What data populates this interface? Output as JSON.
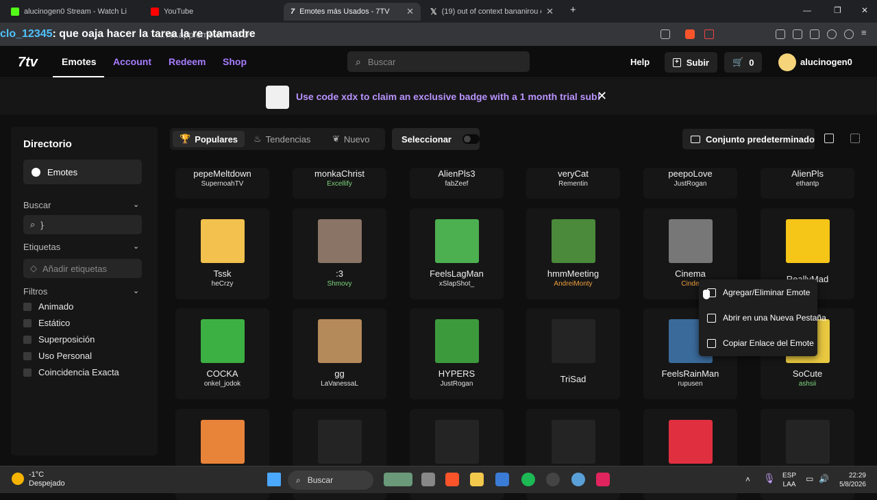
{
  "browser": {
    "tabs": [
      {
        "title": "alucinogen0 Stream - Watch Live"
      },
      {
        "title": "YouTube"
      },
      {
        "title": "Emotes más Usados - 7TV"
      },
      {
        "title": "(19) out of context bananirou en X:"
      }
    ],
    "new_tab": "+",
    "url_fragment": "...7tv.app/emotes?...7D"
  },
  "chat_overlay": {
    "user": "clo_12345",
    "message": ": que oaja hacer la tarea la re ptamadre"
  },
  "nav": {
    "logo": "7tv",
    "links": [
      "Emotes",
      "Account",
      "Redeem",
      "Shop"
    ],
    "search_placeholder": "Buscar",
    "help": "Help",
    "upload": "Subir",
    "cart_count": "0",
    "username": "alucinogen0"
  },
  "banner": {
    "text": "Use code xdx to claim an exclusive badge with a 1 month trial sub!",
    "close": "✕"
  },
  "sidebar": {
    "title": "Directorio",
    "emotes_button": "Emotes",
    "search_header": "Buscar",
    "search_value": "}",
    "tags_header": "Etiquetas",
    "tags_placeholder": "Añadir etiquetas",
    "filters_header": "Filtros",
    "filters": [
      "Animado",
      "Estático",
      "Superposición",
      "Uso Personal",
      "Coincidencia Exacta"
    ]
  },
  "toolbar": {
    "popular": "Populares",
    "trending": "Tendencias",
    "new": "Nuevo",
    "select": "Seleccionar",
    "default_set": "Conjunto predeterminado"
  },
  "emotes_top": [
    {
      "name": "pepeMeltdown",
      "author": "SupernoahTV",
      "author_color": "#e0e0e0"
    },
    {
      "name": "monkaChrist",
      "author": "Excellify",
      "author_color": "#7ed67e"
    },
    {
      "name": "AlienPls3",
      "author": "fabZeef",
      "author_color": "#e0e0e0"
    },
    {
      "name": "veryCat",
      "author": "Rementin",
      "author_color": "#e0e0e0"
    },
    {
      "name": "peepoLove",
      "author": "JustRogan",
      "author_color": "#e0e0e0"
    },
    {
      "name": "AlienPls",
      "author": "ethantp",
      "author_color": "#e0e0e0"
    }
  ],
  "emotes_row2": [
    {
      "name": "Tssk",
      "author": "heCrzy",
      "author_color": "#e0e0e0",
      "img": "#f2c14e"
    },
    {
      "name": ":3",
      "author": "Shmovy",
      "author_color": "#7ed67e",
      "img": "#8a7466"
    },
    {
      "name": "FeelsLagMan",
      "author": "xSlapShot_",
      "author_color": "#e0e0e0",
      "img": "#4caf50"
    },
    {
      "name": "hmmMeeting",
      "author": "AndreiMonty",
      "author_color": "#f0a040",
      "img": "#4a8a3a"
    },
    {
      "name": "Cinema",
      "author": "Cinde",
      "author_color": "#f0a040",
      "img": "#777777"
    },
    {
      "name": "ReallyMad",
      "author": "",
      "author_color": "#e0e0e0",
      "img": "#f5c518"
    }
  ],
  "emotes_row3": [
    {
      "name": "COCKA",
      "author": "onkel_jodok",
      "author_color": "#e0e0e0",
      "img": "#3cb043"
    },
    {
      "name": "gg",
      "author": "LaVanessaL",
      "author_color": "#e0e0e0",
      "img": "#b58a5a"
    },
    {
      "name": "HYPERS",
      "author": "JustRogan",
      "author_color": "#e0e0e0",
      "img": "#3c9a3c"
    },
    {
      "name": "TriSad",
      "author": "",
      "author_color": "#e0e0e0",
      "img": "#242424"
    },
    {
      "name": "FeelsRainMan",
      "author": "rupusen",
      "author_color": "#e0e0e0",
      "img": "#3a6a9a"
    },
    {
      "name": "SoCute",
      "author": "ashsii",
      "author_color": "#7ed67e",
      "img": "#e8c840"
    }
  ],
  "emotes_row4": [
    {
      "img": "#e8833a"
    },
    {
      "img": "#242424"
    },
    {
      "img": "#242424"
    },
    {
      "img": "#242424"
    },
    {
      "img": "#e03040"
    },
    {
      "img": "#242424"
    }
  ],
  "context_menu": [
    "Agregar/Eliminar Emote",
    "Abrir en una Nueva Pestaña",
    "Copiar Enlace del Emote"
  ],
  "taskbar": {
    "temp": "-1°C",
    "weather": "Despejado",
    "search": "Buscar",
    "lang": "ESP",
    "region": "LAA",
    "time": "22:29",
    "date": "5/8/2026"
  },
  "colors": {
    "accent": "#a77cff",
    "banner_text": "#b993ff"
  }
}
